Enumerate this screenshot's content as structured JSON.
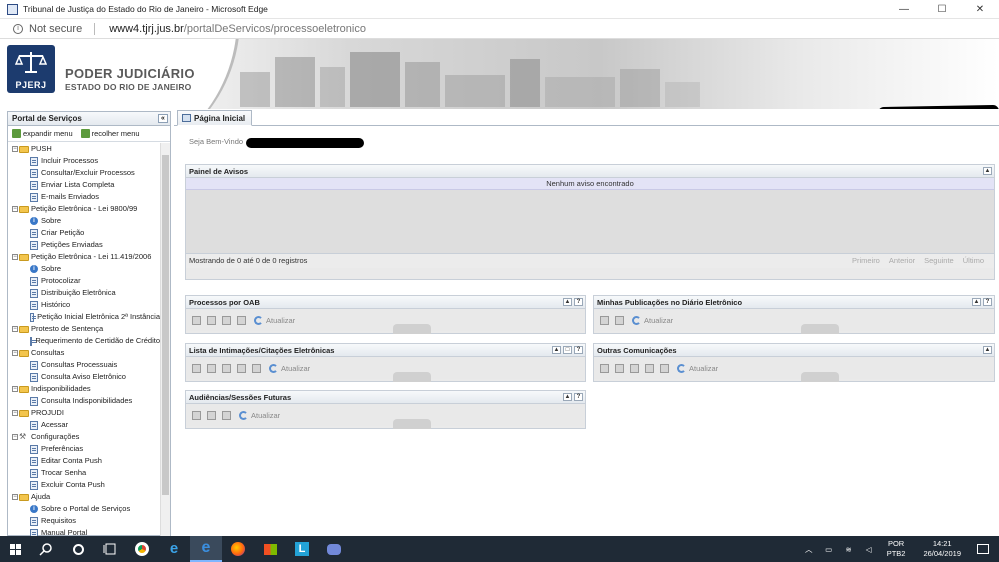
{
  "window": {
    "title": "Tribunal de Justiça do Estado do Rio de Janeiro - Microsoft Edge",
    "minimize": "—",
    "maximize": "☐",
    "close": "✕"
  },
  "address": {
    "security": "Not secure",
    "host": "www4.tjrj.jus.br",
    "path": "/portalDeServicos/processoeletronico"
  },
  "header": {
    "logo_text": "PJERJ",
    "brand_line1": "PODER JUDICIÁRIO",
    "brand_line2": "ESTADO DO RIO DE JANEIRO"
  },
  "sidebar": {
    "title": "Portal de Serviços",
    "collapse": "«",
    "expand_label": "expandir menu",
    "collapse_label": "recolher menu",
    "tree": [
      {
        "label": "PUSH",
        "icon": "folder",
        "children": [
          {
            "label": "Incluir Processos",
            "icon": "doc"
          },
          {
            "label": "Consultar/Excluir Processos",
            "icon": "doc"
          },
          {
            "label": "Enviar Lista Completa",
            "icon": "doc"
          },
          {
            "label": "E-mails Enviados",
            "icon": "doc"
          }
        ]
      },
      {
        "label": "Petição Eletrônica - Lei 9800/99",
        "icon": "folder",
        "children": [
          {
            "label": "Sobre",
            "icon": "info"
          },
          {
            "label": "Criar Petição",
            "icon": "doc"
          },
          {
            "label": "Petições Enviadas",
            "icon": "doc"
          }
        ]
      },
      {
        "label": "Petição Eletrônica - Lei 11.419/2006",
        "icon": "folder",
        "children": [
          {
            "label": "Sobre",
            "icon": "info"
          },
          {
            "label": "Protocolizar",
            "icon": "doc"
          },
          {
            "label": "Distribuição Eletrônica",
            "icon": "doc"
          },
          {
            "label": "Histórico",
            "icon": "doc"
          },
          {
            "label": "Petição Inicial Eletrônica 2ª Instância",
            "icon": "doc"
          }
        ]
      },
      {
        "label": "Protesto de Sentença",
        "icon": "folder",
        "children": [
          {
            "label": "Requerimento de Certidão de Crédito",
            "icon": "doc"
          }
        ]
      },
      {
        "label": "Consultas",
        "icon": "folder",
        "children": [
          {
            "label": "Consultas Processuais",
            "icon": "doc"
          },
          {
            "label": "Consulta Aviso Eletrônico",
            "icon": "doc"
          }
        ]
      },
      {
        "label": "Indisponibilidades",
        "icon": "folder",
        "children": [
          {
            "label": "Consulta Indisponibilidades",
            "icon": "doc"
          }
        ]
      },
      {
        "label": "PROJUDI",
        "icon": "folder",
        "children": [
          {
            "label": "Acessar",
            "icon": "doc"
          }
        ]
      },
      {
        "label": "Configurações",
        "icon": "wrench",
        "children": [
          {
            "label": "Preferências",
            "icon": "doc"
          },
          {
            "label": "Editar Conta Push",
            "icon": "doc"
          },
          {
            "label": "Trocar Senha",
            "icon": "doc"
          },
          {
            "label": "Excluir Conta Push",
            "icon": "doc"
          }
        ]
      },
      {
        "label": "Ajuda",
        "icon": "folder",
        "children": [
          {
            "label": "Sobre o Portal de Serviços",
            "icon": "info"
          },
          {
            "label": "Requisitos",
            "icon": "doc"
          },
          {
            "label": "Manual Portal",
            "icon": "doc"
          }
        ]
      }
    ]
  },
  "main": {
    "tab_label": "Página Inicial",
    "welcome": "Seja Bem-Vindo",
    "avisos": {
      "title": "Painel de Avisos",
      "empty": "Nenhum aviso encontrado",
      "footer": "Mostrando de 0 até 0 de 0 registros",
      "pager": [
        "Primeiro",
        "Anterior",
        "Seguinte",
        "Último"
      ]
    },
    "refresh_label": "Atualizar",
    "panels": {
      "oab": "Processos por OAB",
      "publicacoes": "Minhas Publicações no Diário Eletrônico",
      "intimacoes": "Lista de Intimações/Citações Eletrônicas",
      "outras": "Outras Comunicações",
      "audiencias": "Audiências/Sessões Futuras"
    }
  },
  "taskbar": {
    "lang1": "POR",
    "lang2": "PTB2",
    "time": "14:21",
    "date": "26/04/2019"
  },
  "colors": {
    "taskbar": "#1f2a36",
    "header_accent": "#1c3b6e",
    "panel_border": "#c8cfd8"
  }
}
